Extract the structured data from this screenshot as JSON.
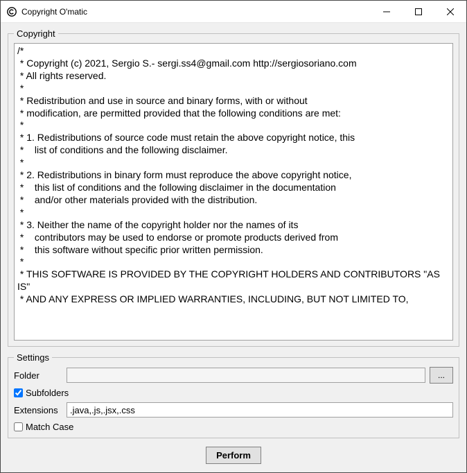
{
  "window": {
    "title": "Copyright O'matic"
  },
  "copyright": {
    "legend": "Copyright",
    "text": "/*\n * Copyright (c) 2021, Sergio S.- sergi.ss4@gmail.com http://sergiosoriano.com\n * All rights reserved.\n *\n * Redistribution and use in source and binary forms, with or without\n * modification, are permitted provided that the following conditions are met:\n *\n * 1. Redistributions of source code must retain the above copyright notice, this\n *    list of conditions and the following disclaimer.\n *\n * 2. Redistributions in binary form must reproduce the above copyright notice,\n *    this list of conditions and the following disclaimer in the documentation\n *    and/or other materials provided with the distribution.\n *\n * 3. Neither the name of the copyright holder nor the names of its\n *    contributors may be used to endorse or promote products derived from\n *    this software without specific prior written permission.\n *\n * THIS SOFTWARE IS PROVIDED BY THE COPYRIGHT HOLDERS AND CONTRIBUTORS \"AS IS\"\n * AND ANY EXPRESS OR IMPLIED WARRANTIES, INCLUDING, BUT NOT LIMITED TO,"
  },
  "settings": {
    "legend": "Settings",
    "folder_label": "Folder",
    "folder_value": "",
    "browse_label": "...",
    "subfolders_label": "Subfolders",
    "subfolders_checked": true,
    "extensions_label": "Extensions",
    "extensions_value": ".java,.js,.jsx,.css",
    "matchcase_label": "Match Case",
    "matchcase_checked": false
  },
  "perform_label": "Perform"
}
